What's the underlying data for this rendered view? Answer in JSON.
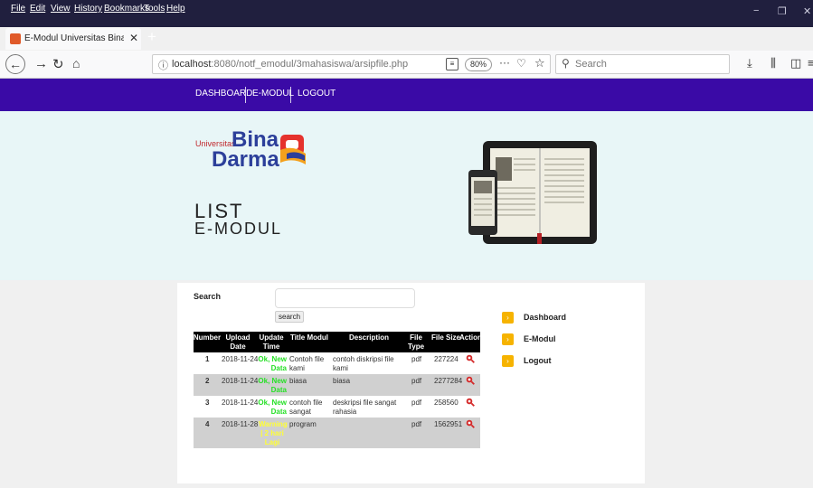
{
  "menubar": {
    "items": [
      "File",
      "Edit",
      "View",
      "History",
      "Bookmarks",
      "Tools",
      "Help"
    ]
  },
  "tab": {
    "title": "E-Modul Universitas Bina Darma",
    "close": "✕",
    "new": "+"
  },
  "toolbar": {
    "url_host": "localhost",
    "url_rest": ":8080/notf_emodul/3mahasiswa/arsipfile.php",
    "zoom": "80%",
    "search_placeholder": "Search"
  },
  "nav": {
    "items": [
      "DASHBOARD",
      "E-MODUL",
      "LOGOUT"
    ]
  },
  "logo": {
    "prefix": "Universitas",
    "line1": "Bina",
    "line2": "Darma"
  },
  "hero": {
    "title": "LIST",
    "subtitle": "E-MODUL"
  },
  "search": {
    "label": "Search",
    "button": "search"
  },
  "table": {
    "headers": [
      "Number",
      "Upload Date",
      "Update Time",
      "Title Modul",
      "Description",
      "File Type",
      "File Size",
      "Action"
    ],
    "rows": [
      {
        "number": "1",
        "date": "2018-11-24",
        "status": "Ok, New Data",
        "title": "Contoh file kami",
        "desc": "contoh diskripsi file kami",
        "type": "pdf",
        "size": "227224"
      },
      {
        "number": "2",
        "date": "2018-11-24",
        "status": "Ok, New Data",
        "title": "biasa",
        "desc": "biasa",
        "type": "pdf",
        "size": "2277284"
      },
      {
        "number": "3",
        "date": "2018-11-24",
        "status": "Ok, New Data",
        "title": "contoh file sangat rahasia",
        "desc": "deskripsi file sangat rahasia",
        "type": "pdf",
        "size": "258560"
      },
      {
        "number": "4",
        "date": "2018-11-28",
        "status": "Warning | 2 hari Lagi",
        "title": "program",
        "desc": "",
        "type": "pdf",
        "size": "1562951"
      }
    ]
  },
  "sidebar": {
    "items": [
      {
        "label": "Dashboard",
        "icon": "arrow-right-icon"
      },
      {
        "label": "E-Modul",
        "icon": "arrow-right-icon"
      },
      {
        "label": "Logout",
        "icon": "arrow-right-icon"
      }
    ]
  },
  "colors": {
    "menubar": "#201f3e",
    "nav": "#3a0aa6",
    "hero": "#e8f6f7",
    "accent": "#f6b300",
    "ok": "#27e027",
    "warn": "#ffff33"
  }
}
